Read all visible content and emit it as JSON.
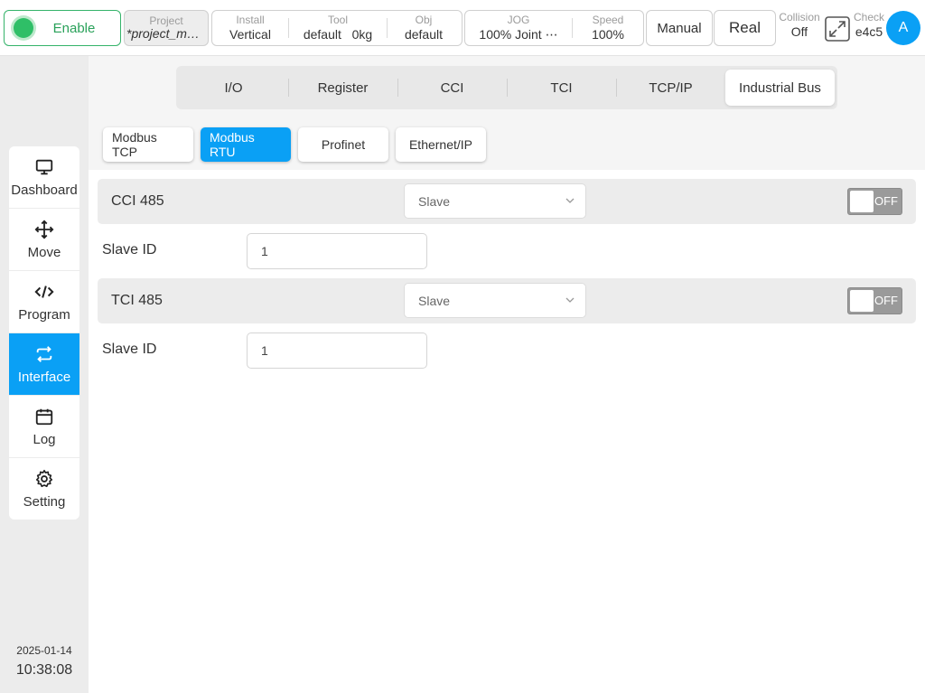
{
  "topbar": {
    "enable_label": "Enable",
    "project": {
      "caption": "Project",
      "value": "*project_mo⋯"
    },
    "install": {
      "caption": "Install",
      "value": "Vertical"
    },
    "tool": {
      "caption": "Tool",
      "value": "default",
      "payload": "0kg"
    },
    "obj": {
      "caption": "Obj",
      "value": "default"
    },
    "jog": {
      "caption": "JOG",
      "value": "100%  Joint ⋯"
    },
    "speed": {
      "caption": "Speed",
      "value": "100%"
    },
    "mode_label": "Manual",
    "env_label": "Real",
    "collision": {
      "caption": "Collision",
      "value": "Off"
    },
    "check": {
      "caption": "Check",
      "value": "e4c5"
    },
    "avatar_letter": "A"
  },
  "sidebar": {
    "items": [
      {
        "label": "Dashboard",
        "icon": "monitor-icon"
      },
      {
        "label": "Move",
        "icon": "move-arrows-icon"
      },
      {
        "label": "Program",
        "icon": "code-icon"
      },
      {
        "label": "Interface",
        "icon": "swap-arrows-icon",
        "active": true
      },
      {
        "label": "Log",
        "icon": "calendar-icon"
      },
      {
        "label": "Setting",
        "icon": "gear-icon"
      }
    ],
    "date": "2025-01-14",
    "time": "10:38:08"
  },
  "tabs": [
    "I/O",
    "Register",
    "CCI",
    "TCI",
    "TCP/IP",
    "Industrial Bus"
  ],
  "active_tab": "Industrial Bus",
  "subtabs": [
    "Modbus TCP",
    "Modbus RTU",
    "Profinet",
    "Ethernet/IP"
  ],
  "active_subtab": "Modbus RTU",
  "sections": [
    {
      "title": "CCI 485",
      "mode": "Slave",
      "toggle": "OFF",
      "field_label": "Slave ID",
      "field_value": "1"
    },
    {
      "title": "TCI 485",
      "mode": "Slave",
      "toggle": "OFF",
      "field_label": "Slave ID",
      "field_value": "1"
    }
  ],
  "colors": {
    "accent": "#0aa0f5",
    "enable_green": "#2fbf67"
  }
}
